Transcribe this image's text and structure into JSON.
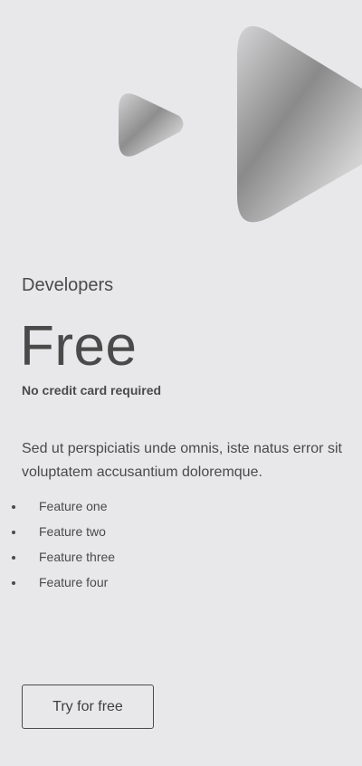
{
  "hero": {
    "small_icon": "play-triangle-icon",
    "large_icon": "play-triangle-icon"
  },
  "plan": {
    "name": "Developers",
    "price": "Free",
    "price_note": "No credit card required",
    "description": "Sed ut perspiciatis unde omnis, iste natus error sit voluptatem accusantium doloremque.",
    "features": [
      "Feature one",
      "Feature two",
      "Feature three",
      "Feature four"
    ],
    "cta_label": "Try for free"
  },
  "colors": {
    "background": "#e8e8ea",
    "text": "#4a4a4a",
    "border": "#4a4a4a"
  }
}
